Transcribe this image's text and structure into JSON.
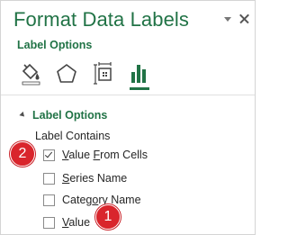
{
  "pane": {
    "title": "Format Data Labels",
    "options_link": "Label Options",
    "tab_icons": [
      "fill-line-icon",
      "effects-pentagon-icon",
      "size-properties-icon",
      "label-options-bars-icon"
    ],
    "active_tab": 3
  },
  "section": {
    "header": "Label Options",
    "sub_label": "Label Contains",
    "options": [
      {
        "pre": "",
        "u": "V",
        "post": "alue ",
        "u2": "F",
        "post2": "rom Cells",
        "checked": true
      },
      {
        "pre": "",
        "u": "S",
        "post": "eries Name",
        "checked": false
      },
      {
        "pre": "Categ",
        "u": "o",
        "post": "ry Name",
        "checked": false
      },
      {
        "pre": "",
        "u": "V",
        "post": "alue",
        "checked": false
      }
    ]
  },
  "callouts": {
    "badge_2": "2",
    "badge_1": "1"
  },
  "colors": {
    "accent_green": "#217346",
    "callout_red": "#d9252c"
  }
}
